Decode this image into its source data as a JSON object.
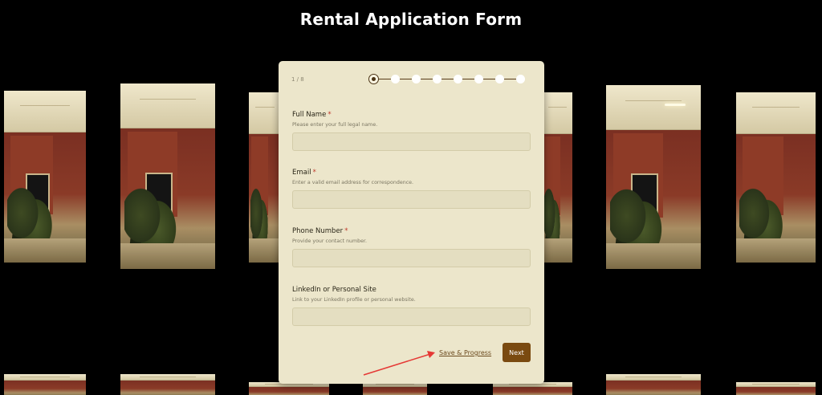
{
  "page": {
    "title": "Rental Application Form"
  },
  "form": {
    "step_indicator": "1 / 8",
    "total_steps": 8,
    "current_step": 1,
    "fields": [
      {
        "label": "Full Name",
        "required_mark": "*",
        "help": "Please enter your full legal name.",
        "value": "",
        "placeholder": ""
      },
      {
        "label": "Email",
        "required_mark": "*",
        "help": "Enter a valid email address for correspondence.",
        "value": "",
        "placeholder": ""
      },
      {
        "label": "Phone Number",
        "required_mark": "*",
        "help": "Provide your contact number.",
        "value": "",
        "placeholder": ""
      },
      {
        "label": "LinkedIn or Personal Site",
        "help": "Link to your LinkedIn profile or personal website.",
        "value": "",
        "placeholder": ""
      }
    ],
    "actions": {
      "save_label": "Save & Progress",
      "next_label": "Next"
    }
  },
  "colors": {
    "card_background": "#ece6cb",
    "accent": "#7a4a10",
    "required": "#c0392b",
    "annotation_arrow": "#e53935"
  }
}
